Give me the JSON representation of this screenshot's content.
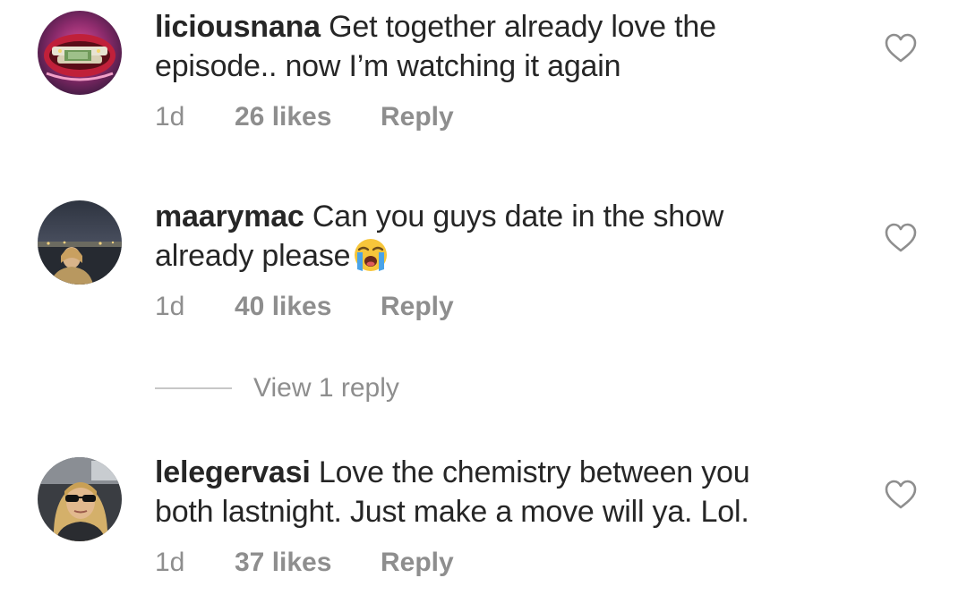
{
  "comments": [
    {
      "username": "liciousnana",
      "line1": "Get together already  love the",
      "line2": "episode.. now I’m watching it again",
      "time": "1d",
      "likes": "26 likes",
      "reply": "Reply",
      "avatar_icon": "grillz-mouth-avatar"
    },
    {
      "username": "maarymac",
      "line1": "Can you guys date in the show",
      "line2": "already please",
      "line2_emoji": "loudly-crying-face-emoji",
      "time": "1d",
      "likes": "40 likes",
      "reply": "Reply",
      "avatar_icon": "person-at-night-avatar"
    },
    {
      "username": "lelegervasi",
      "line1": "Love the chemistry between you",
      "line2": "both lastnight. Just make a move will ya. Lol.",
      "time": "1d",
      "likes": "37 likes",
      "reply": "Reply",
      "avatar_icon": "woman-sunglasses-avatar"
    }
  ],
  "view_replies": {
    "label": "View 1 reply"
  },
  "colors": {
    "text": "#262626",
    "secondary": "#8e8e8e",
    "divider": "#c7c7c7",
    "background": "#ffffff"
  },
  "icons": {
    "like": "heart-outline-icon"
  }
}
